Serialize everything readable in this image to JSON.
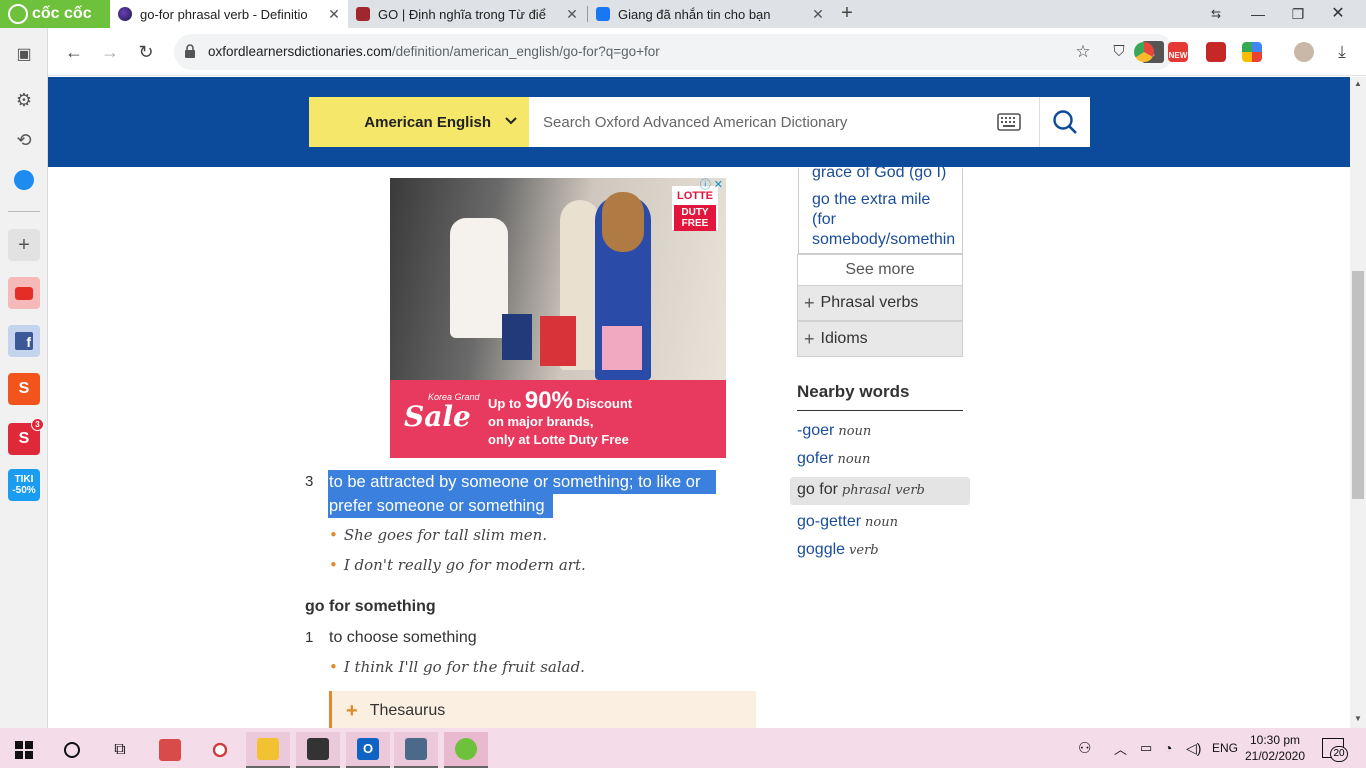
{
  "browser": {
    "brand": "cốc cốc",
    "tabs": [
      {
        "title": "go-for phrasal verb - Definitio",
        "active": true
      },
      {
        "title": "GO | Định nghĩa trong Từ điể",
        "active": false
      },
      {
        "title": "Giang đã nhắn tin cho bạn",
        "active": false
      }
    ],
    "url_host": "oxfordlearnersdictionaries.com",
    "url_path": "/definition/american_english/go-for?q=go+for"
  },
  "sidebar": {
    "badge_count": "3",
    "tiki_label": "TIKI",
    "tiki_discount": "-50%"
  },
  "site": {
    "language": "American English",
    "search_placeholder": "Search Oxford Advanced American Dictionary"
  },
  "ad": {
    "brand_top": "LOTTE",
    "brand_box": "DUTY FREE",
    "close": "ⓘ ✕",
    "korea_grand": "Korea Grand",
    "sale": "Sale",
    "line1_prefix": "Up to",
    "line1_value": "90%",
    "line1_suffix": "Discount",
    "line2": "on major brands,",
    "line3": "only at Lotte Duty Free"
  },
  "entry": {
    "sense3_number": "3",
    "sense3_def_line1": "to be attracted by someone or something; to like or",
    "sense3_def_line2": "prefer someone or something",
    "sense3_examples": [
      "She goes for tall slim men.",
      "I don't really go for modern art."
    ],
    "phrase_heading": "go for something",
    "phrase_sense1_number": "1",
    "phrase_sense1_def": "to choose something",
    "phrase_sense1_example": "I think I'll go for the fruit salad.",
    "thesaurus_label": "Thesaurus"
  },
  "related": {
    "entries": [
      "grace of God (go I)",
      "go the extra mile",
      "(for",
      "somebody/somethin"
    ],
    "see_more": "See more",
    "accordions": [
      "Phrasal verbs",
      "Idioms"
    ]
  },
  "nearby": {
    "heading": "Nearby words",
    "items": [
      {
        "word": "-goer",
        "pos": "noun"
      },
      {
        "word": "gofer",
        "pos": "noun"
      },
      {
        "word": "go for",
        "pos": "phrasal verb",
        "current": true
      },
      {
        "word": "go-getter",
        "pos": "noun"
      },
      {
        "word": "goggle",
        "pos": "verb"
      }
    ]
  },
  "taskbar": {
    "language": "ENG",
    "time": "10:30 pm",
    "date": "21/02/2020",
    "notifications": "20"
  },
  "colors": {
    "oxford_blue": "#0c4b9c",
    "language_yellow": "#f4e76a",
    "highlight": "#3a80dc",
    "link": "#1a4d9a",
    "example_dot": "#e08a2a",
    "coccoc_green": "#6ec23b",
    "ad_pink": "#e73a5e"
  },
  "icons": [
    "coccoc-logo-icon",
    "settings-gear-icon",
    "history-icon",
    "messenger-icon",
    "youtube-icon",
    "facebook-icon",
    "shopee-icon",
    "sendo-icon",
    "tiki-icon",
    "back-icon",
    "forward-icon",
    "reload-icon",
    "lock-icon",
    "bookmark-star-icon",
    "shield-icon",
    "download-icon",
    "keyboard-icon",
    "search-icon",
    "windows-start-icon",
    "cortana-icon",
    "task-view-icon"
  ]
}
